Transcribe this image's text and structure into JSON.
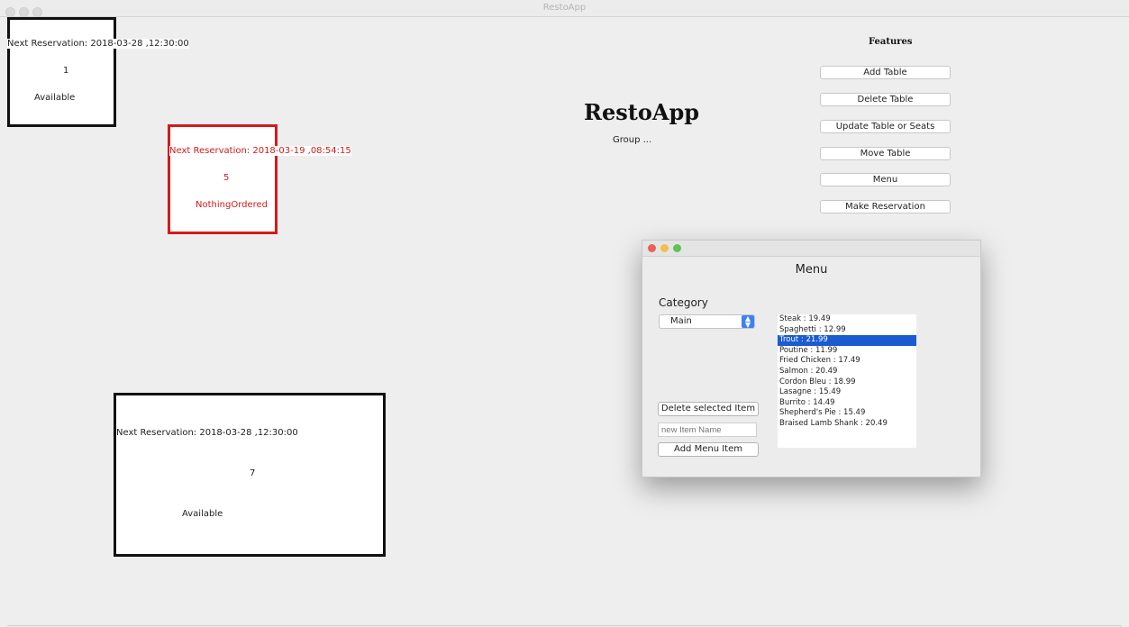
{
  "window": {
    "title": "RestoApp"
  },
  "header": {
    "title": "RestoApp",
    "subtitle": "Group ..."
  },
  "tables": [
    {
      "next_reservation": "Next Reservation: 2018-03-28 ,12:30:00",
      "number": "1",
      "status": "Available"
    },
    {
      "next_reservation": "Next Reservation: 2018-03-19 ,08:54:15",
      "number": "5",
      "status": "NothingOrdered"
    },
    {
      "next_reservation": "Next Reservation: 2018-03-28 ,12:30:00",
      "number": "7",
      "status": "Available"
    }
  ],
  "features": {
    "title": "Features",
    "buttons": [
      "Add Table",
      "Delete Table",
      "Update Table or Seats",
      "Move Table",
      "Menu",
      "Make Reservation"
    ]
  },
  "menu_dialog": {
    "title": "Menu",
    "category_label": "Category",
    "category_selected": "Main",
    "items": [
      "Steak : 19.49",
      "Spaghetti : 12.99",
      "Trout : 21.99",
      "Poutine : 11.99",
      "Fried Chicken : 17.49",
      "Salmon : 20.49",
      "Cordon Bleu : 18.99",
      "Lasagne : 15.49",
      "Burrito : 14.49",
      "Shepherd's Pie : 15.49",
      "Braised Lamb Shank : 20.49"
    ],
    "selected_item": "Trout : 21.99",
    "delete_button": "Delete selected Item",
    "new_item_placeholder": "new Item Name",
    "add_button": "Add Menu Item"
  },
  "colors": {
    "reserved_border": "#d41a1a",
    "selection": "#1a5bd0",
    "select_arrow": "#3b82f6",
    "close": "#ee5f57",
    "minimize": "#f4bd4f",
    "maximize": "#5fc454"
  },
  "icons": [
    "close-icon",
    "minimize-icon",
    "maximize-icon",
    "select-arrows-icon"
  ]
}
